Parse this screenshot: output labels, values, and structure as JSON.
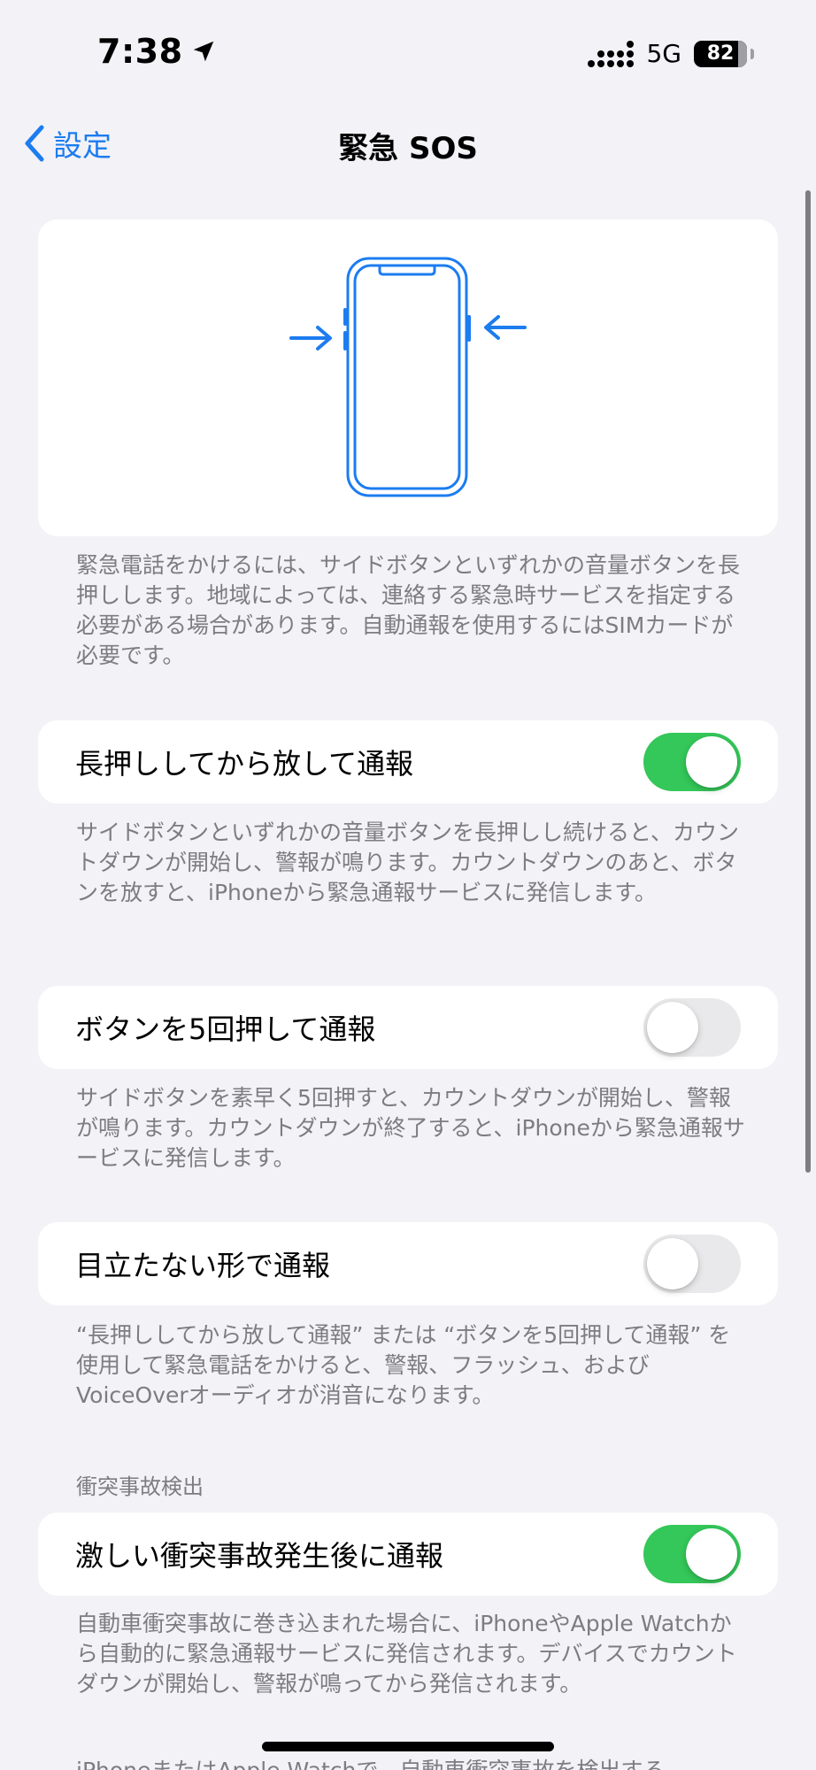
{
  "status_bar": {
    "time": "7:38",
    "network": "5G",
    "battery": "82"
  },
  "nav": {
    "back_label": "設定",
    "title": "緊急 SOS"
  },
  "hero": {
    "description": "緊急電話をかけるには、サイドボタンといずれかの音量ボタンを長押しします。地域によっては、連絡する緊急時サービスを指定する必要がある場合があります。自動通報を使用するにはSIMカードが必要です。"
  },
  "settings": [
    {
      "label": "長押ししてから放して通報",
      "enabled": true,
      "footer": "サイドボタンといずれかの音量ボタンを長押しし続けると、カウントダウンが開始し、警報が鳴ります。カウントダウンのあと、ボタンを放すと、iPhoneから緊急通報サービスに発信します。"
    },
    {
      "label": "ボタンを5回押して通報",
      "enabled": false,
      "footer": "サイドボタンを素早く5回押すと、カウントダウンが開始し、警報が鳴ります。カウントダウンが終了すると、iPhoneから緊急通報サービスに発信します。"
    },
    {
      "label": "目立たない形で通報",
      "enabled": false,
      "footer": "“長押ししてから放して通報” または “ボタンを5回押して通報” を使用して緊急電話をかけると、警報、フラッシュ、およびVoiceOverオーディオが消音になります。"
    }
  ],
  "crash_section": {
    "header": "衝突事故検出",
    "label": "激しい衝突事故発生後に通報",
    "enabled": true,
    "footer": "自動車衝突事故に巻き込まれた場合に、iPhoneやApple Watchから自動的に緊急通報サービスに発信されます。デバイスでカウントダウンが開始し、警報が鳴ってから発信されます。",
    "next_footer_partial": "iPhoneまたはApple Watchで、自動車衝突事故を検出する"
  },
  "colors": {
    "accent": "#1c7cf0",
    "toggle_on": "#34c759",
    "toggle_off": "#e9e9eb",
    "background": "#f2f2f7",
    "footer_text": "#7c7c82"
  }
}
